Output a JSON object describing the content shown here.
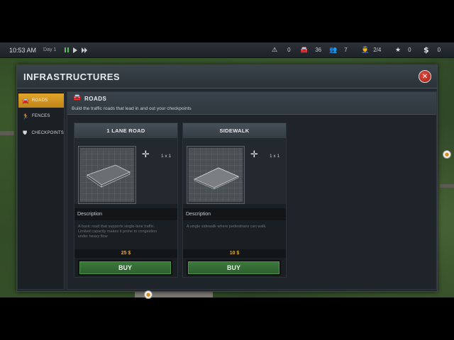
{
  "hud": {
    "time": "10:53 AM",
    "day": "Day 1",
    "stats": [
      {
        "icon": "warning-icon",
        "glyph": "⚠",
        "value": "0"
      },
      {
        "icon": "car-icon",
        "glyph": "🚘",
        "value": "36"
      },
      {
        "icon": "pedestrians-icon",
        "glyph": "👥",
        "value": "7"
      },
      {
        "icon": "staff-icon",
        "glyph": "👮",
        "value": "2/4"
      },
      {
        "icon": "star-icon",
        "glyph": "★",
        "value": "0"
      },
      {
        "icon": "money-icon",
        "glyph": "$",
        "value": "0"
      }
    ]
  },
  "modal": {
    "title": "INFRASTRUCTURES",
    "close_glyph": "✕"
  },
  "sidebar": {
    "items": [
      {
        "label": "ROADS",
        "glyph": "🚘",
        "active": true
      },
      {
        "label": "FENCES",
        "glyph": "🏃",
        "active": false
      },
      {
        "label": "CHECKPOINTS",
        "glyph": "⛊",
        "active": false
      }
    ]
  },
  "category": {
    "title": "ROADS",
    "glyph": "🚘",
    "subtitle": "Build the traffic roads that lead in and out your checkpoints"
  },
  "cards": [
    {
      "name": "1 LANE ROAD",
      "size": "1 x 1",
      "description_label": "Description",
      "description": "A basic road that supports single-lane traffic. Limited capacity makes it prone to congestion under heavy flow",
      "price": "25 $",
      "buy_label": "BUY"
    },
    {
      "name": "SIDEWALK",
      "size": "1 x 1",
      "description_label": "Description",
      "description": "A single sidewalk where pedestrians can walk.",
      "price": "10 $",
      "buy_label": "BUY"
    }
  ],
  "colors": {
    "accent": "#e2a52b",
    "buy_green": "#3c7a3c",
    "price": "#e0a83a",
    "close_red": "#c9342a"
  }
}
